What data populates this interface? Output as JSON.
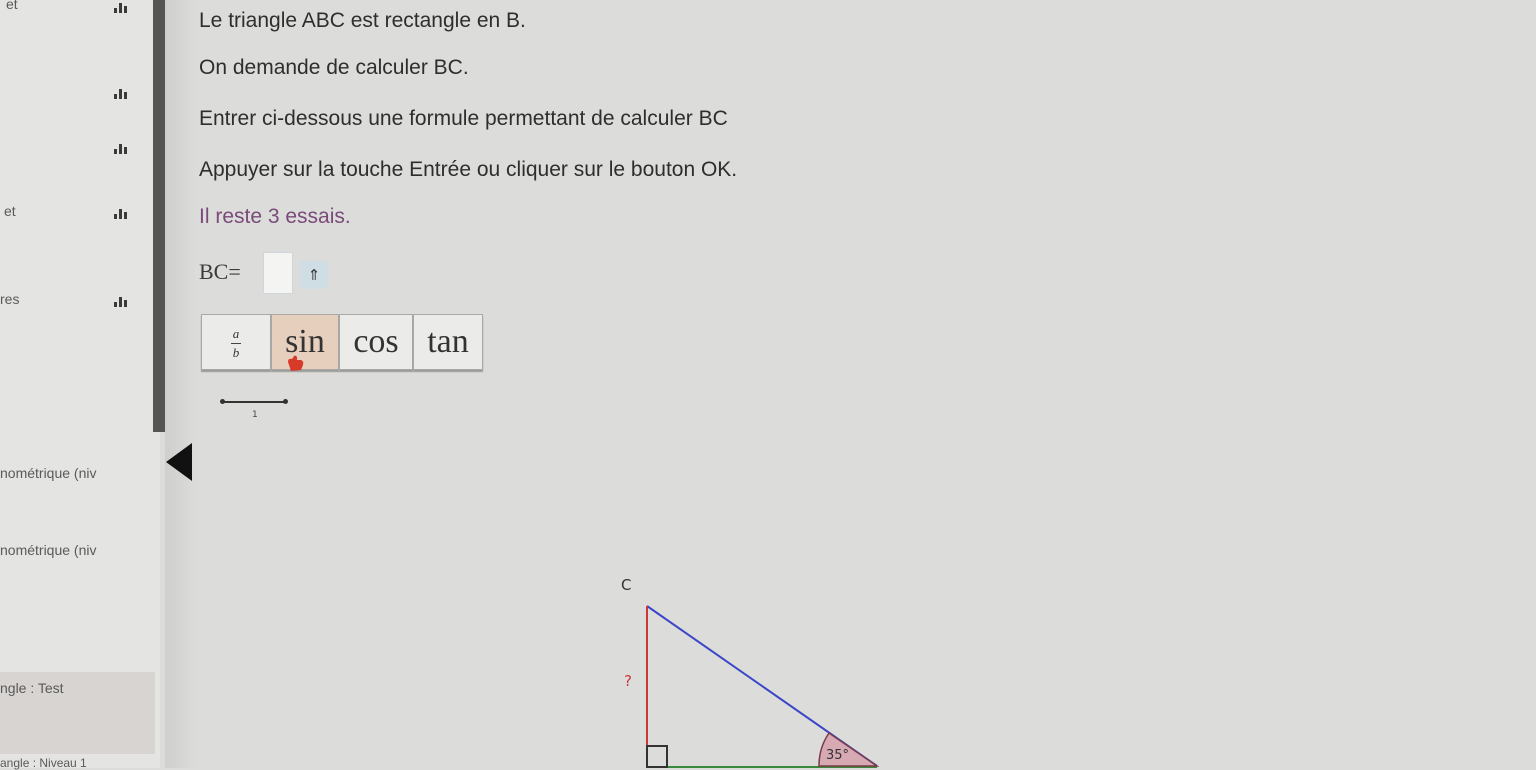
{
  "sidebar": {
    "items": [
      {
        "label": "et"
      },
      {
        "label": "et"
      },
      {
        "label": "res"
      },
      {
        "label": "nométrique (niv"
      },
      {
        "label": "nométrique (niv"
      },
      {
        "label": "ngle : Test"
      },
      {
        "label": "angle : Niveau 1"
      }
    ]
  },
  "exercise": {
    "statement": "Le triangle ABC est rectangle en B.",
    "question": "On demande de calculer BC.",
    "instruction": "Entrer ci-dessous une formule permettant de calculer BC",
    "hint": "Appuyer sur la touche Entrée ou cliquer sur le bouton OK.",
    "tries": "Il reste 3 essais."
  },
  "answer": {
    "label": "BC=",
    "value": "",
    "keyboard_toggle": "⇑"
  },
  "keypad": {
    "fraction": {
      "numerator": "a",
      "denominator": "b"
    },
    "keys": [
      {
        "label": "sin"
      },
      {
        "label": "cos"
      },
      {
        "label": "tan"
      }
    ]
  },
  "segment_label": "1",
  "figure": {
    "vertex_c": "C",
    "unknown": "?",
    "angle": "35°"
  },
  "colors": {
    "hypotenuse": "#3a46c8",
    "side_bc": "#c8383c",
    "angle_fill": "#d7a9b3",
    "active_key": "#e6cfbd"
  }
}
